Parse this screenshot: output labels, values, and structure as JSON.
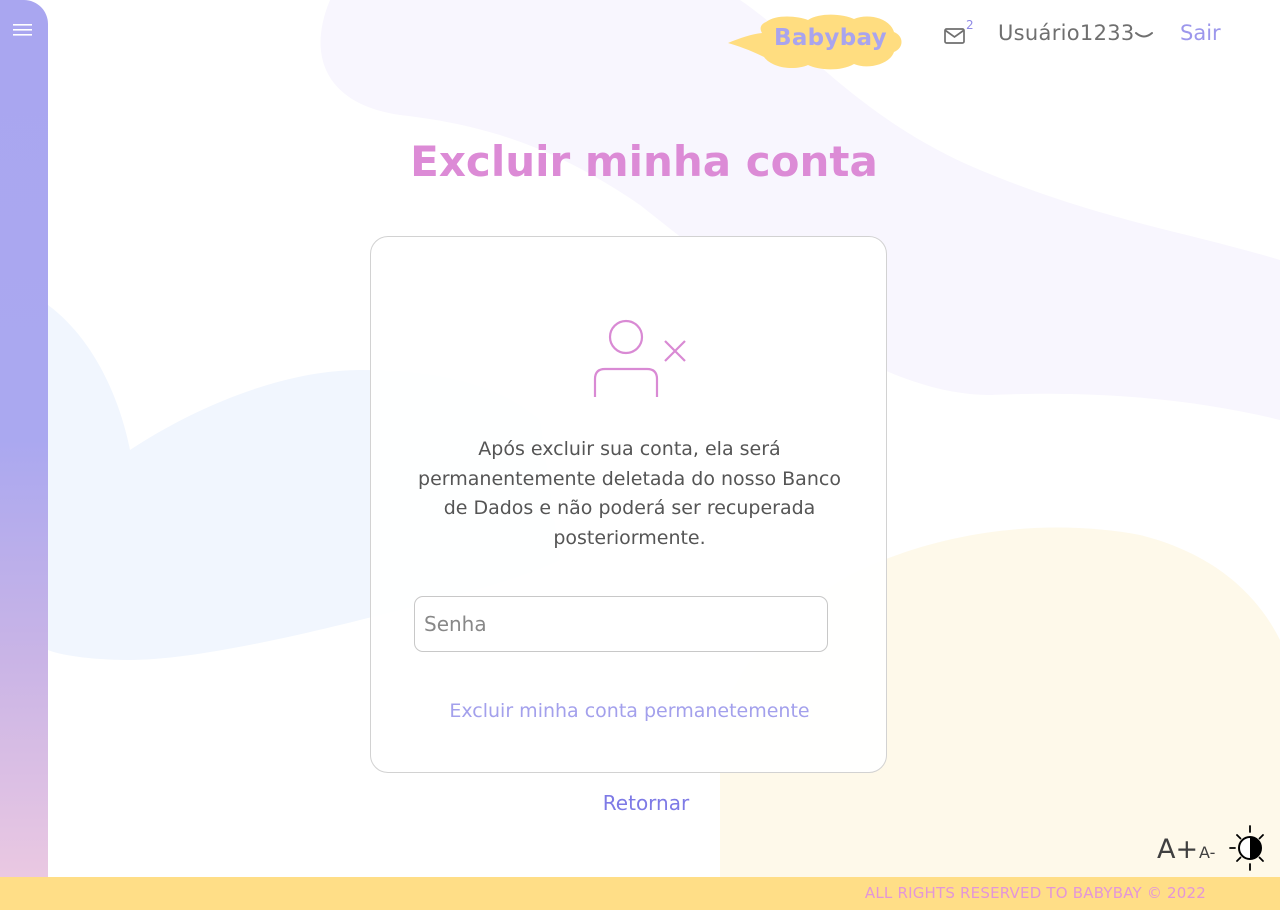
{
  "header": {
    "logo_text": "Babybay",
    "mail_count": "2",
    "username": "Usuário1233",
    "logout_label": "Sair"
  },
  "page": {
    "title": "Excluir minha conta"
  },
  "card": {
    "icon": "user-remove-icon",
    "message": "Após excluir sua conta, ela será permanentemente deletada do nosso Banco de Dados e não poderá ser recuperada posteriormente.",
    "password_placeholder": "Senha",
    "password_value": "",
    "delete_button_label": "Excluir minha conta permanetemente"
  },
  "return_label": "Retornar",
  "accessibility": {
    "increase_font_label": "A+",
    "decrease_font_label": "A-",
    "contrast_icon": "contrast-icon"
  },
  "footer": {
    "copyright": "ALL RIGHTS RESERVED TO BABYBAY © 2022"
  },
  "colors": {
    "sidebar": "#aaa8f0",
    "title_pink": "#dc8bd6",
    "accent_purple": "#9c97ec",
    "logo_yellow": "#ffdd80",
    "footer_yellow": "#ffde87"
  }
}
